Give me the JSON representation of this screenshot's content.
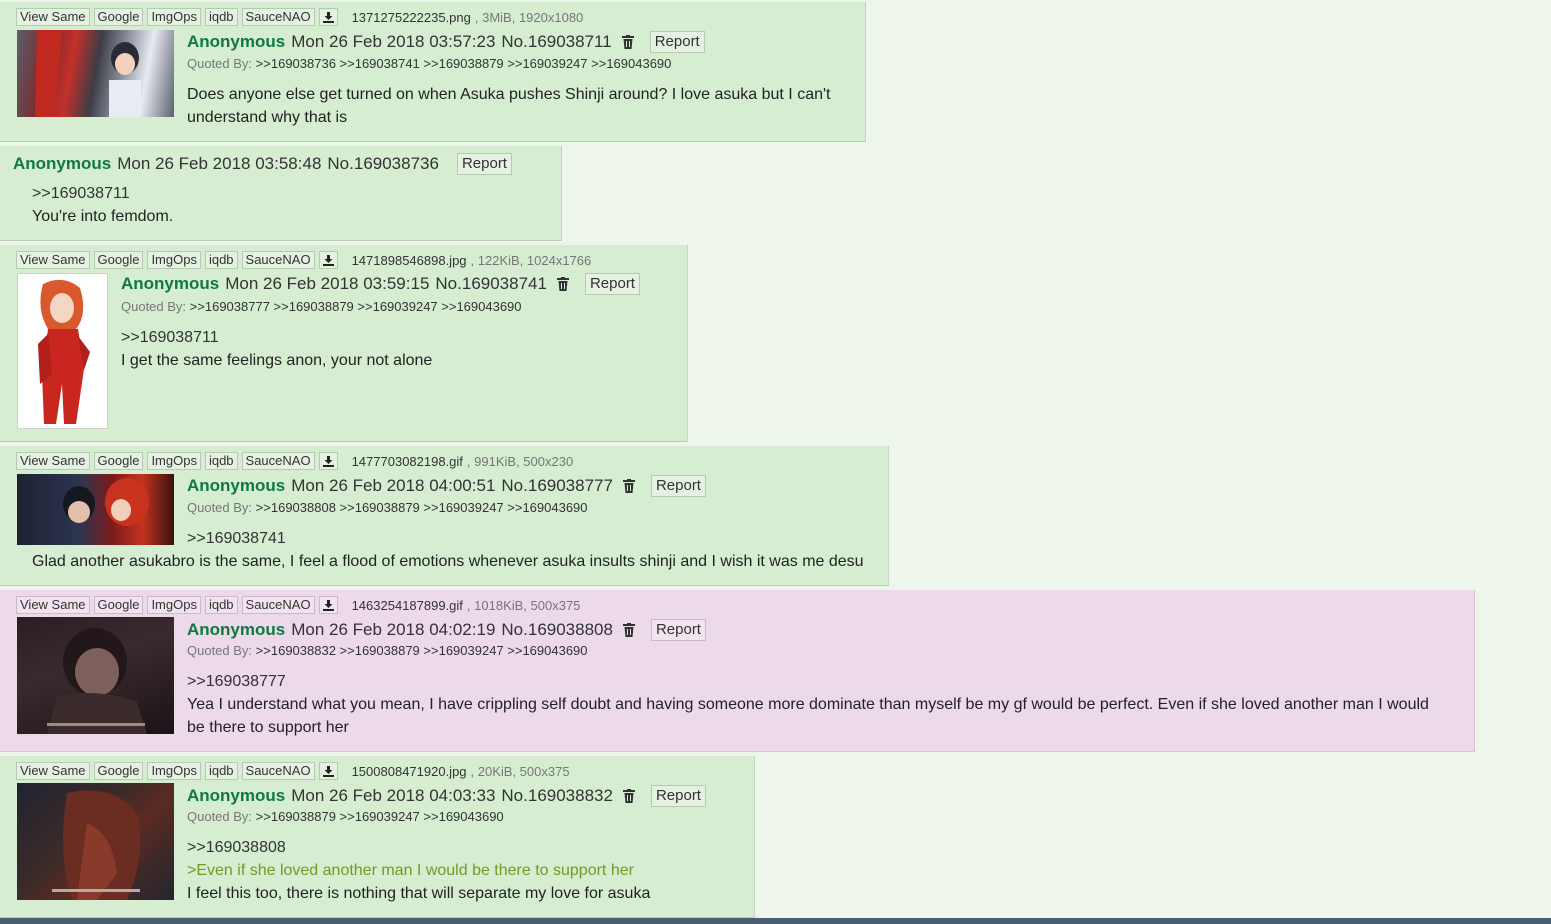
{
  "toolbar_labels": [
    "View Same",
    "Google",
    "ImgOps",
    "iqdb",
    "SauceNAO"
  ],
  "report_label": "Report",
  "quoted_by_label": "Quoted By:",
  "posts": [
    {
      "file": {
        "name": "1371275222235.png",
        "meta": ", 3MiB, 1920x1080"
      },
      "name": "Anonymous",
      "date": "Mon 26 Feb 2018 03:57:23",
      "no": "No.169038711",
      "quoted": ">>169038736 >>169038741 >>169038879 >>169039247 >>169043690",
      "lines": [
        "Does anyone else get turned on when Asuka pushes Shinji around? I love asuka but I can't",
        "understand why that is"
      ]
    },
    {
      "name": "Anonymous",
      "date": "Mon 26 Feb 2018 03:58:48",
      "no": "No.169038736",
      "lines": [
        ">>169038711",
        "You're into femdom."
      ]
    },
    {
      "file": {
        "name": "1471898546898.jpg",
        "meta": ", 122KiB, 1024x1766"
      },
      "name": "Anonymous",
      "date": "Mon 26 Feb 2018 03:59:15",
      "no": "No.169038741",
      "quoted": ">>169038777 >>169038879 >>169039247 >>169043690",
      "lines": [
        ">>169038711",
        "I get the same feelings anon, your not alone"
      ]
    },
    {
      "file": {
        "name": "1477703082198.gif",
        "meta": ", 991KiB, 500x230"
      },
      "name": "Anonymous",
      "date": "Mon 26 Feb 2018 04:00:51",
      "no": "No.169038777",
      "quoted": ">>169038808 >>169038879 >>169039247 >>169043690",
      "lines": [
        ">>169038741",
        "Glad another asukabro is the same, I feel a flood of emotions whenever asuka insults shinji and I wish it was me desu"
      ]
    },
    {
      "file": {
        "name": "1463254187899.gif",
        "meta": ", 1018KiB, 500x375"
      },
      "name": "Anonymous",
      "date": "Mon 26 Feb 2018 04:02:19",
      "no": "No.169038808",
      "quoted": ">>169038832 >>169038879 >>169039247 >>169043690",
      "lines": [
        ">>169038777",
        "Yea I understand what you mean, I have crippling self doubt and having someone more dominate than myself be my gf would be perfect. Even if she loved another man I would",
        "be there to support her"
      ]
    },
    {
      "file": {
        "name": "1500808471920.jpg",
        "meta": ", 20KiB, 500x375"
      },
      "name": "Anonymous",
      "date": "Mon 26 Feb 2018 04:03:33",
      "no": "No.169038832",
      "quoted": ">>169038879 >>169039247 >>169043690",
      "lines": [
        ">>169038808",
        ">Even if she loved another man I would be there to support her",
        "I feel this too, there is nothing that will separate my love for asuka"
      ]
    }
  ],
  "colors": {
    "name": "#117743",
    "greentext": "#789922",
    "post_bg": "#d6edd2",
    "highlight_bg": "#ecd9ea"
  }
}
